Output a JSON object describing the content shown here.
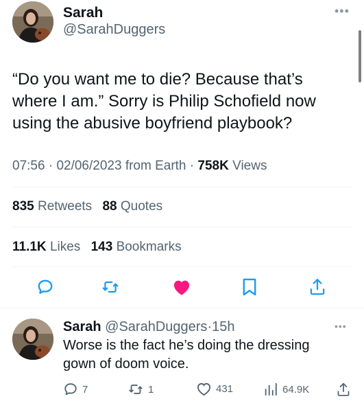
{
  "main_tweet": {
    "author_name": "Sarah",
    "author_handle": "@SarahDuggers",
    "text": "“Do you want me to die? Because that’s where I am.” Sorry is Philip Schofield now using the abusive boyfriend playbook?",
    "time": "07:56",
    "date": "02/06/2023",
    "source": "from Earth",
    "separator": "·",
    "views_count": "758K",
    "views_label": "Views",
    "retweets_count": "835",
    "retweets_label": "Retweets",
    "quotes_count": "88",
    "quotes_label": "Quotes",
    "likes_count": "11.1K",
    "likes_label": "Likes",
    "bookmarks_count": "143",
    "bookmarks_label": "Bookmarks",
    "liked": true
  },
  "reply": {
    "author_name": "Sarah",
    "author_handle": "@SarahDuggers",
    "age": "15h",
    "separator": "·",
    "text": "Worse is the fact he’s doing the dressing gown of doom voice.",
    "reply_count": "7",
    "retweet_count": "1",
    "like_count": "431",
    "views_count": "64.9K"
  },
  "icons": {
    "more": "more-horizontal-icon",
    "reply": "speech-bubble-icon",
    "retweet": "retweet-arrows-icon",
    "like": "heart-icon",
    "bookmark": "bookmark-icon",
    "share": "share-upload-icon",
    "views": "bar-chart-icon"
  },
  "colors": {
    "text": "#0f1419",
    "secondary": "#536471",
    "accent": "#1d9bf0",
    "like": "#f91880",
    "divider": "#eff3f4"
  }
}
